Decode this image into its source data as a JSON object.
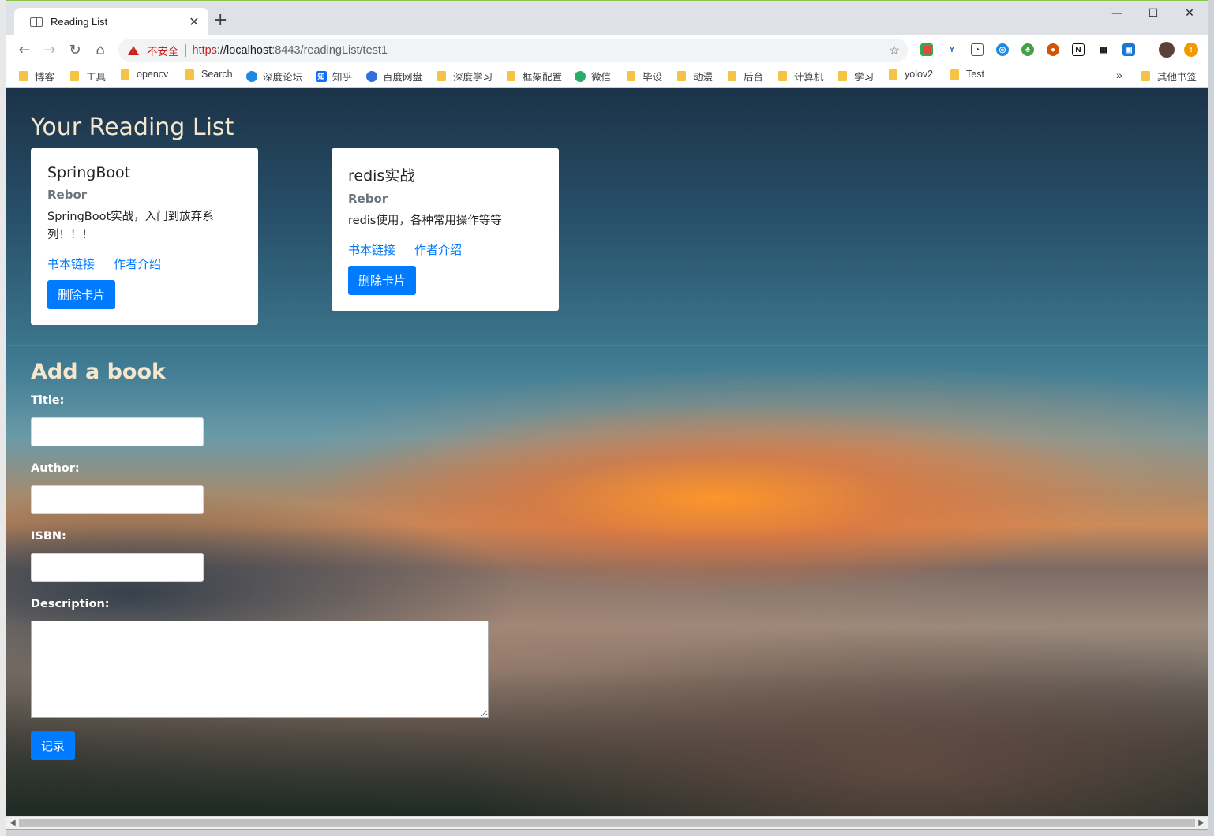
{
  "tab": {
    "title": "Reading List"
  },
  "address_bar": {
    "security_label": "不安全",
    "url_scheme": "https",
    "url_host": "://localhost",
    "url_rest": ":8443/readingList/test1"
  },
  "bookmarks": [
    "博客",
    "工具",
    "opencv",
    "Search",
    "深度论坛",
    "知乎",
    "百度网盘",
    "深度学习",
    "框架配置",
    "微信",
    "毕设",
    "动漫",
    "后台",
    "计算机",
    "学习",
    "yolov2",
    "Test"
  ],
  "bookmarks_overflow": "»",
  "bookmarks_other": "其他书签",
  "page": {
    "title": "Your Reading List",
    "books": [
      {
        "title": "SpringBoot",
        "author": "Rebor",
        "description": "SpringBoot实战，入门到放弃系列！！！",
        "link_book": "书本链接",
        "link_author": "作者介绍",
        "delete_label": "删除卡片"
      },
      {
        "title": "redis实战",
        "author": "Rebor",
        "description": "redis使用，各种常用操作等等",
        "link_book": "书本链接",
        "link_author": "作者介绍",
        "delete_label": "删除卡片"
      }
    ],
    "form": {
      "heading": "Add a book",
      "title_label": "Title:",
      "author_label": "Author:",
      "isbn_label": "ISBN:",
      "description_label": "Description:",
      "submit_label": "记录"
    }
  },
  "colors": {
    "accent": "#007bff",
    "heading": "#f5e6cd",
    "insecure": "#c5221f"
  }
}
